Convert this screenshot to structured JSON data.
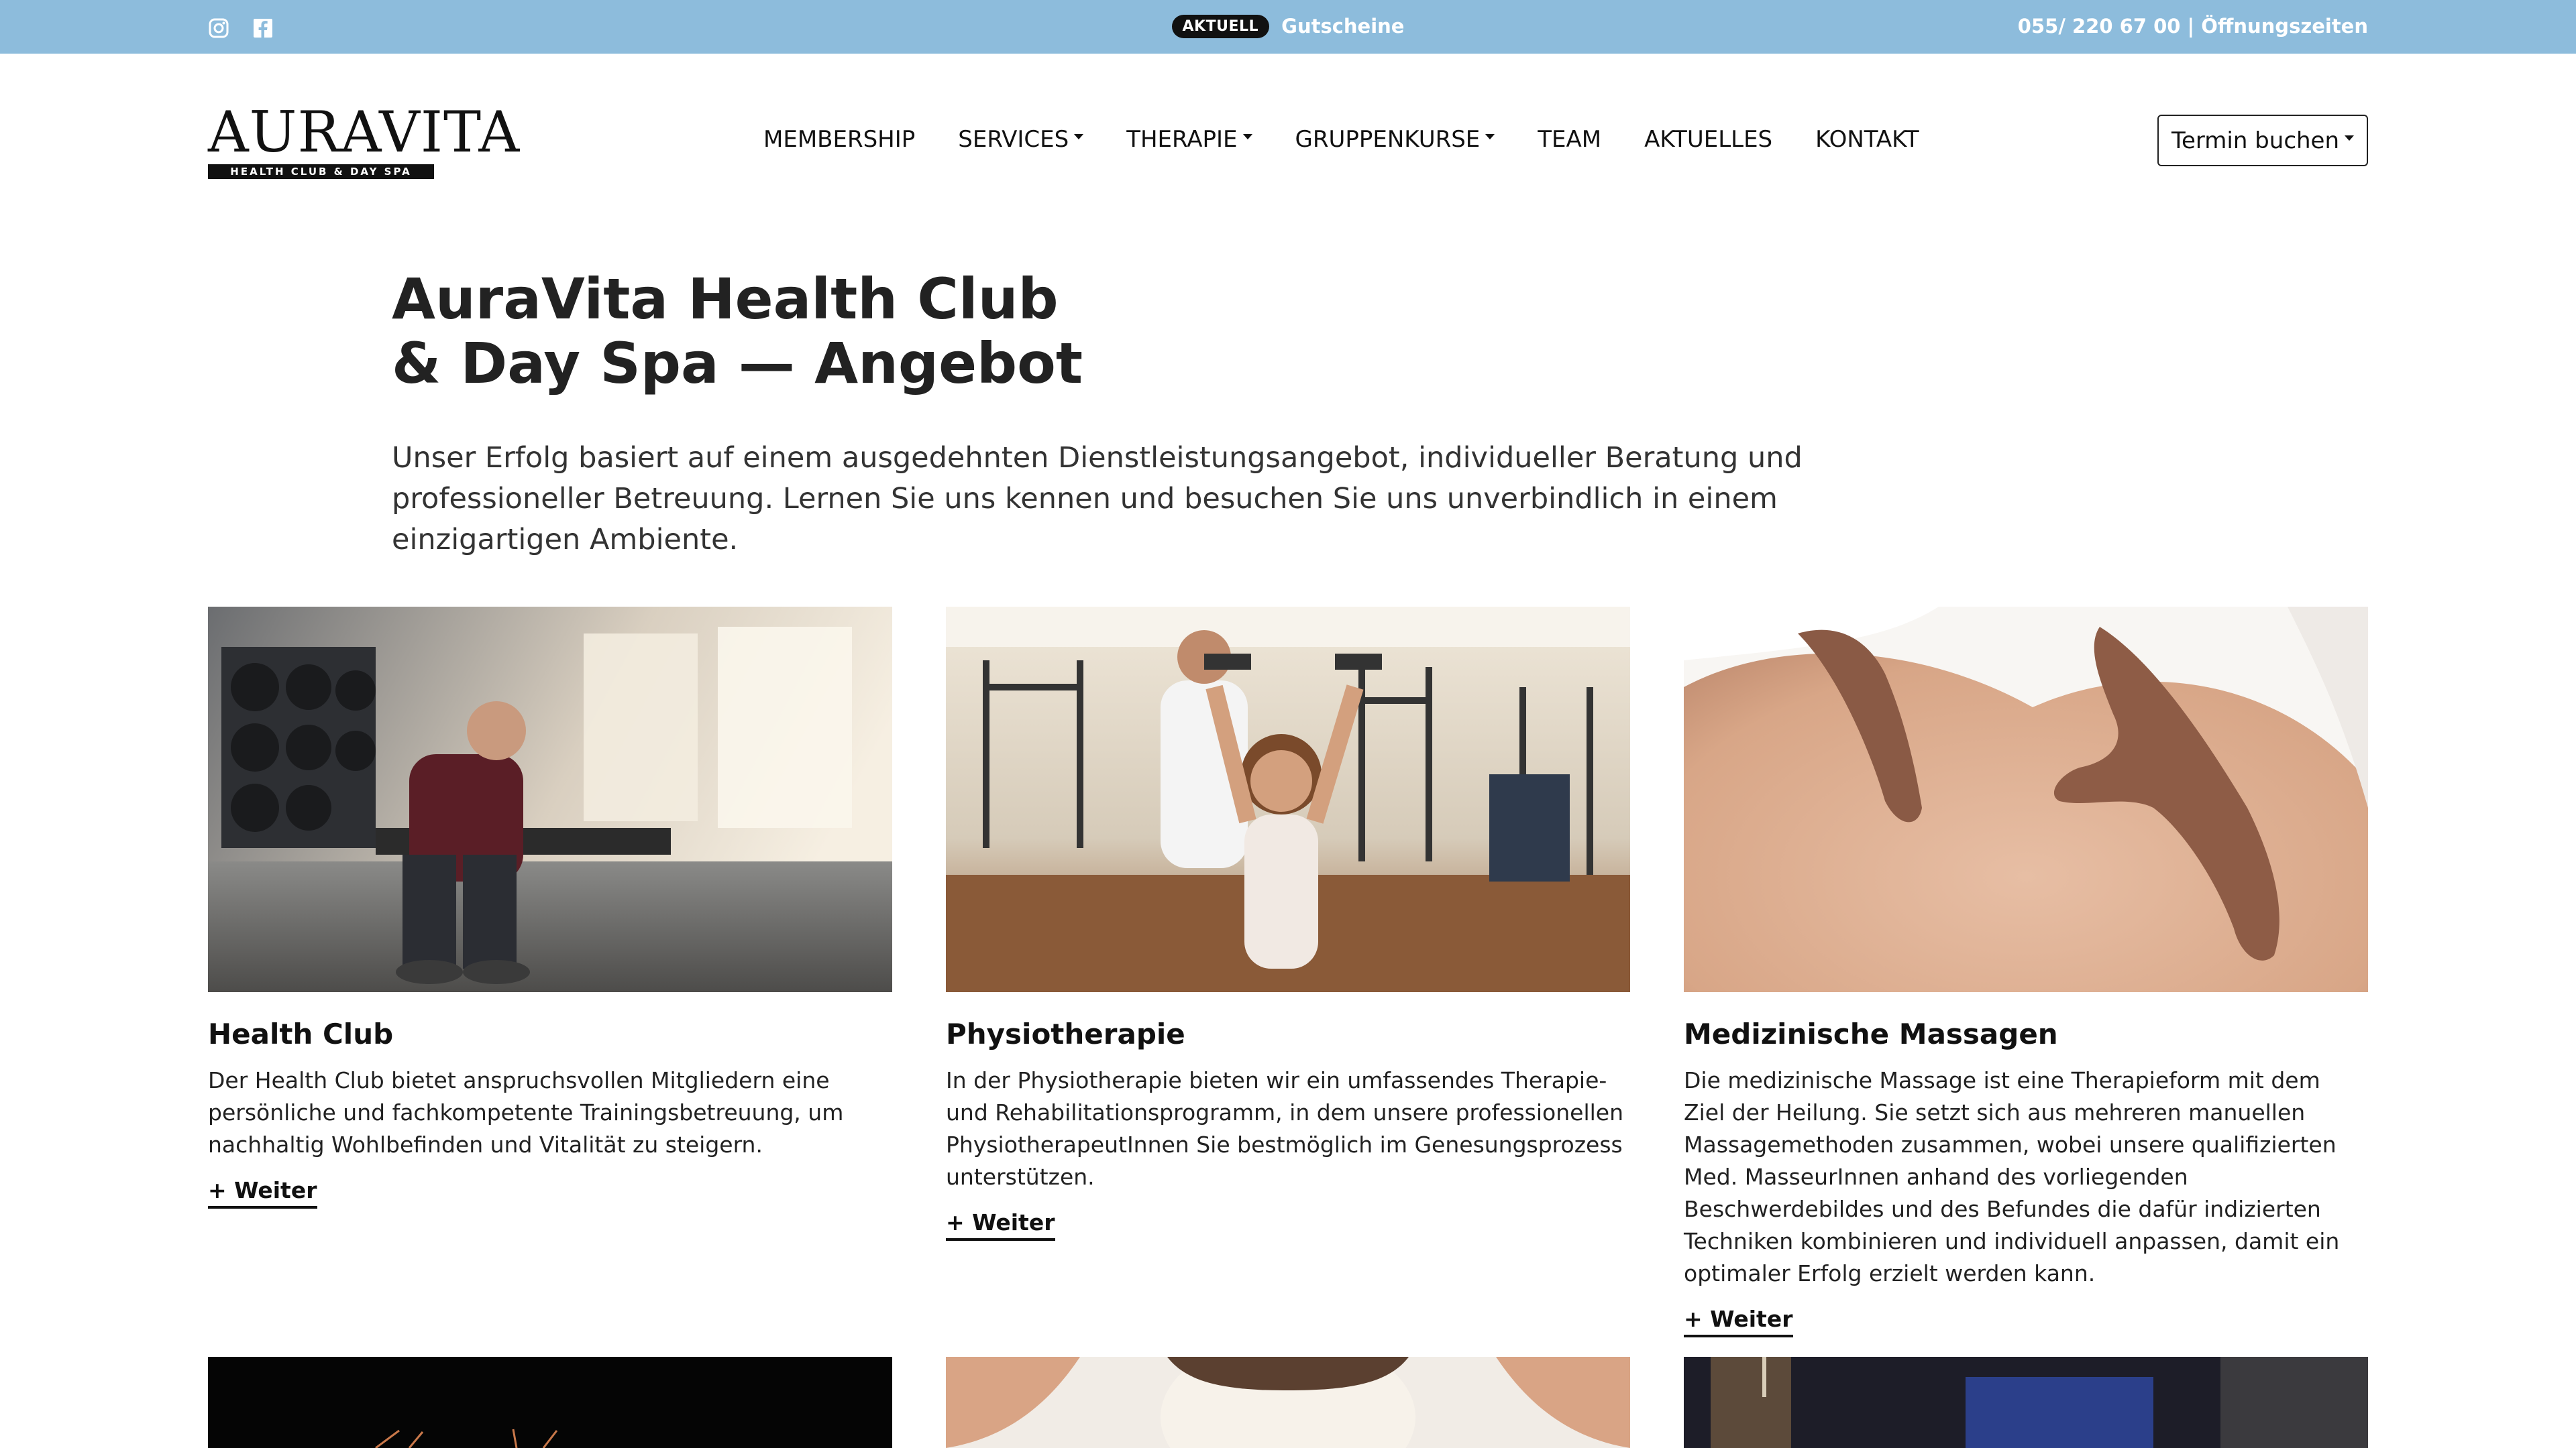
{
  "topbar": {
    "badge": "AKTUELL",
    "promo": "Gutscheine",
    "contact": "055/ 220 67 00 | Öffnungszeiten",
    "social": [
      "instagram-icon",
      "facebook-icon"
    ]
  },
  "logo": {
    "word": "AURAVITA",
    "tagline": "HEALTH CLUB & DAY SPA"
  },
  "nav": {
    "items": [
      {
        "label": "MEMBERSHIP",
        "dropdown": false
      },
      {
        "label": "SERVICES",
        "dropdown": true
      },
      {
        "label": "THERAPIE",
        "dropdown": true
      },
      {
        "label": "GRUPPENKURSE",
        "dropdown": true
      },
      {
        "label": "TEAM",
        "dropdown": false
      },
      {
        "label": "AKTUELLES",
        "dropdown": false
      },
      {
        "label": "KONTAKT",
        "dropdown": false
      }
    ],
    "book_button": "Termin buchen"
  },
  "hero": {
    "title_line1": "AuraVita Health Club",
    "title_line2": "& Day Spa — Angebot",
    "intro": "Unser Erfolg basiert auf einem ausgedehnten Dienstleistungsangebot, individueller Beratung und professioneller Betreuung. Lernen Sie uns kennen und besuchen Sie uns unverbindlich in einem einzigartigen Ambiente."
  },
  "cards": [
    {
      "title": "Health Club",
      "text": "Der Health Club bietet anspruchsvollen Mitgliedern eine persönliche und fachkompetente Trainingsbetreuung, um nachhaltig Wohlbefinden und Vitalität zu steigern.",
      "more": "+ Weiter"
    },
    {
      "title": "Physiotherapie",
      "text": "In der Physiotherapie bieten wir ein umfassendes Therapie- und Rehabilitationsprogramm, in dem unsere professionellen PhysiotherapeutInnen Sie bestmöglich im Genesungsprozess unterstützen.",
      "more": "+ Weiter"
    },
    {
      "title": "Medizinische Massagen",
      "text": "Die medizinische Massage ist eine Therapieform mit dem Ziel der Heilung. Sie setzt sich aus mehreren manuellen Massagemethoden zusammen, wobei unsere qualifizierten Med. MasseurInnen anhand des vorliegenden Beschwerdebildes und des Befundes die dafür indizierten Techniken kombinieren und individuell anpassen, damit ein optimaler Erfolg erzielt werden kann.",
      "more": "+ Weiter"
    }
  ]
}
